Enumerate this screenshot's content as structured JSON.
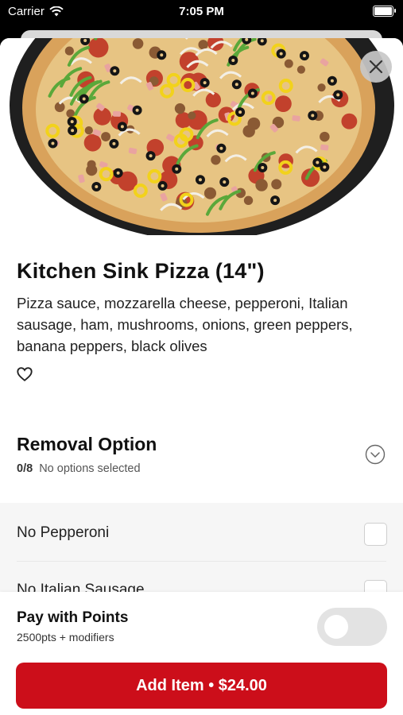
{
  "status_bar": {
    "carrier": "Carrier",
    "time": "7:05 PM"
  },
  "item": {
    "title": "Kitchen Sink Pizza (14\")",
    "description": "Pizza sauce, mozzarella cheese, pepperoni, Italian sausage, ham, mushrooms, onions, green peppers, banana peppers, black olives"
  },
  "removal_option": {
    "title": "Removal Option",
    "count": "0/8",
    "status": "No options selected",
    "options": [
      {
        "label": "No Pepperoni"
      },
      {
        "label": "No Italian Sausage"
      }
    ]
  },
  "footer": {
    "pay_title": "Pay with Points",
    "pay_sub": "2500pts + modifiers",
    "pay_with_points_on": false,
    "add_button": "Add Item • $24.00"
  },
  "colors": {
    "accent": "#cc0e1a"
  },
  "icons": [
    "wifi-icon",
    "battery-icon",
    "close-icon",
    "heart-icon",
    "chevron-down-icon"
  ]
}
